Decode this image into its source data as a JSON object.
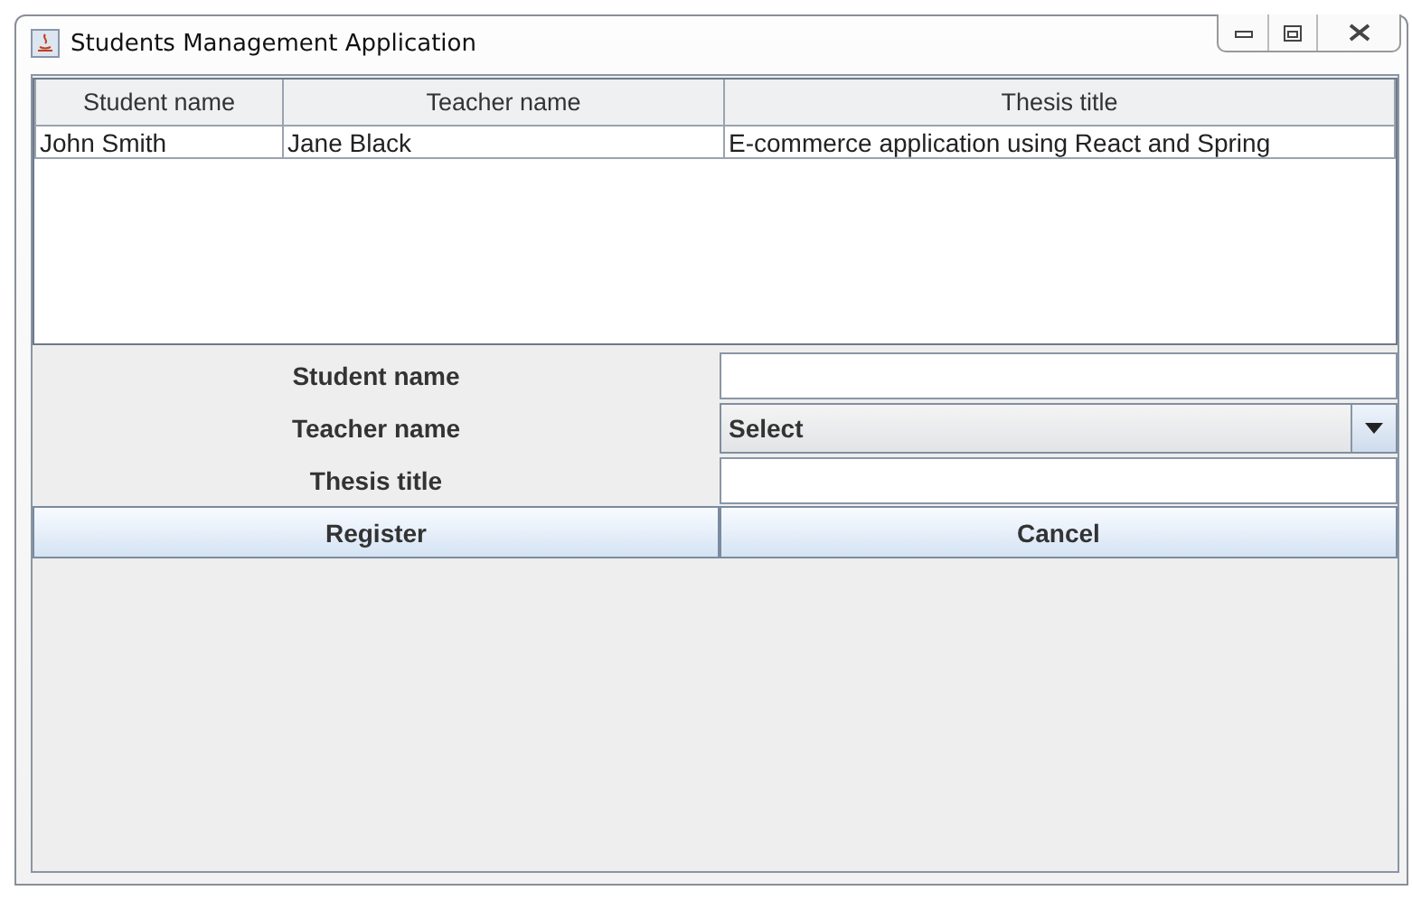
{
  "window": {
    "title": "Students Management Application"
  },
  "table": {
    "columns": [
      "Student name",
      "Teacher name",
      "Thesis title"
    ],
    "rows": [
      [
        "John Smith",
        "Jane Black",
        "E-commerce application using React and Spring"
      ]
    ]
  },
  "form": {
    "fields": [
      {
        "kind": "text",
        "label": "Student name"
      },
      {
        "kind": "select",
        "label": "Teacher name",
        "value": "Select"
      },
      {
        "kind": "text",
        "label": "Thesis title"
      }
    ],
    "buttons": [
      "Register",
      "Cancel"
    ]
  }
}
